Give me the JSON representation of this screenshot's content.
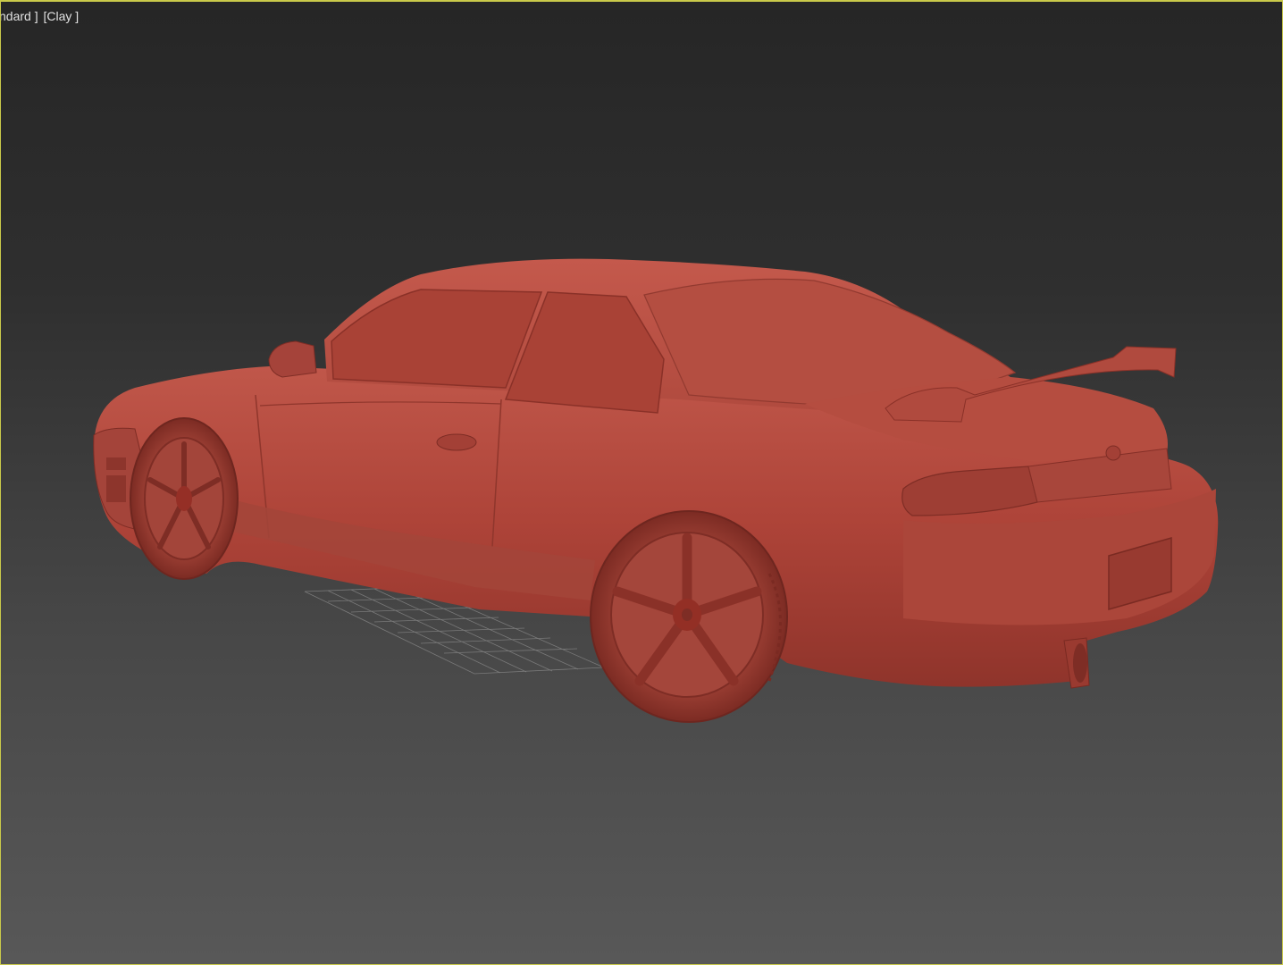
{
  "viewport": {
    "label_shading": "ndard ]",
    "label_style": "[Clay ]",
    "border_color": "#c9c94a"
  },
  "scene": {
    "object": "car-model",
    "clay_color": "#b4493c",
    "grid_icon": "ground-grid-icon"
  }
}
